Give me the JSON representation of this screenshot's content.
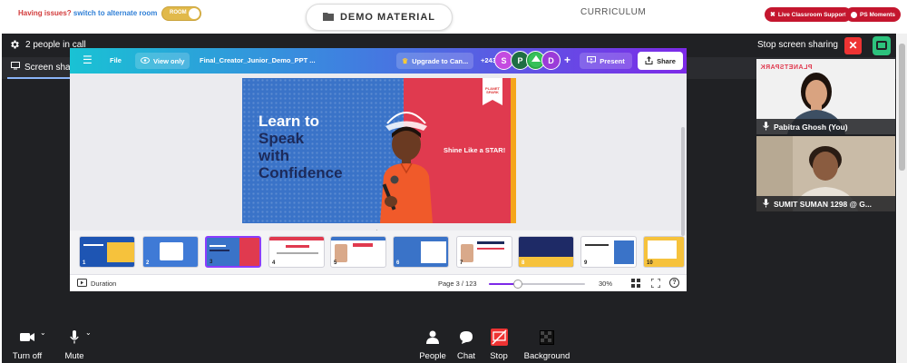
{
  "topbar": {
    "issue_text": "Having issues?",
    "alt_link": "switch to alternate room",
    "room_toggle_label": "ROOM",
    "demo_label": "DEMO MATERIAL",
    "curriculum_label": "CURRICULUM",
    "live_support_label": "Live Classroom Support",
    "ps_moments_label": "PS Moments"
  },
  "call": {
    "people_count_label": "2 people in call",
    "stop_sharing_label": "Stop screen sharing",
    "tab_label": "Screen share (You)",
    "tab_more": "•••"
  },
  "canva": {
    "file_label": "File",
    "view_only_label": "View only",
    "doc_title": "Final_Creator_Junior_Demo_PPT ...",
    "upgrade_label": "Upgrade to Can...",
    "collab_count": "+243",
    "avatars": [
      "S",
      "P",
      "D"
    ],
    "add_label": "+",
    "present_label": "Present",
    "share_label": "Share",
    "duration_label": "Duration",
    "page_label": "Page 3 / 123",
    "zoom_label": "30%",
    "zoom_fraction": 0.3,
    "help_label": "?"
  },
  "slide": {
    "headline_line1": "Learn to",
    "headline_line2": "Speak",
    "headline_line3": "with",
    "headline_line4": "Confidence",
    "tagline": "Shine Like a STAR!",
    "logo_text": "PLANET SPARK"
  },
  "thumbnails": [
    {
      "num": "1",
      "title": "Take the first step to..."
    },
    {
      "num": "2",
      "title": "Trusted by..."
    },
    {
      "num": "3",
      "title": "Learn to Speak"
    },
    {
      "num": "4",
      "title": "Welcome!"
    },
    {
      "num": "5",
      "title": "Hello!"
    },
    {
      "num": "6",
      "title": "About me"
    },
    {
      "num": "7",
      "title": "About the questions"
    },
    {
      "num": "8",
      "title": "What skills to learn today?"
    },
    {
      "num": "9",
      "title": "Skills covered today"
    },
    {
      "num": "10",
      "title": "Let's P-L-A-Y"
    }
  ],
  "participants": [
    {
      "name": "Pabitra Ghosh (You)",
      "logo": "PLANETSPARK"
    },
    {
      "name": "SUMIT SUMAN 1298 @ G..."
    }
  ],
  "toolbar": {
    "turn_off_label": "Turn off",
    "mute_label": "Mute",
    "people_label": "People",
    "chat_label": "Chat",
    "stop_label": "Stop",
    "background_label": "Background"
  },
  "colors": {
    "brand_gradient_start": "#19c2d4",
    "brand_gradient_end": "#7d2ae8",
    "danger": "#e33333",
    "call_bg": "#202124"
  },
  "icons": [
    "gear-icon",
    "screen-share-icon",
    "hamburger-icon",
    "eye-icon",
    "crown-icon",
    "present-icon",
    "share-icon",
    "video-icon",
    "mic-icon",
    "people-icon",
    "chat-icon",
    "stop-share-icon",
    "background-icon",
    "fullscreen-icon",
    "grid-icon",
    "help-icon"
  ]
}
